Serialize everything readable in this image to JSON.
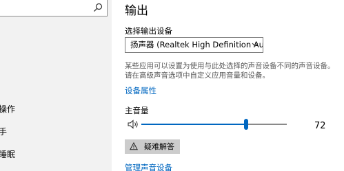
{
  "sidebar": {
    "search_icon": "search-icon",
    "items": [
      {
        "label": "操作"
      },
      {
        "label": "手"
      },
      {
        "label": "睡眠"
      }
    ]
  },
  "output": {
    "title": "输出",
    "device_label": "选择输出设备",
    "device_value": "扬声器 (Realtek High Definition Audi...",
    "description": "某些应用可以设置为使用与此处选择的声音设备不同的声音设备。请在高级声音选项中自定义应用音量和设备。",
    "device_properties_link": "设备属性",
    "master_volume_label": "主音量",
    "volume": 72,
    "volume_text": "72",
    "troubleshoot_label": "疑难解答",
    "manage_devices_link": "管理声音设备"
  },
  "colors": {
    "accent": "#0067c0",
    "sidebar_bg": "#f2f2f2"
  }
}
